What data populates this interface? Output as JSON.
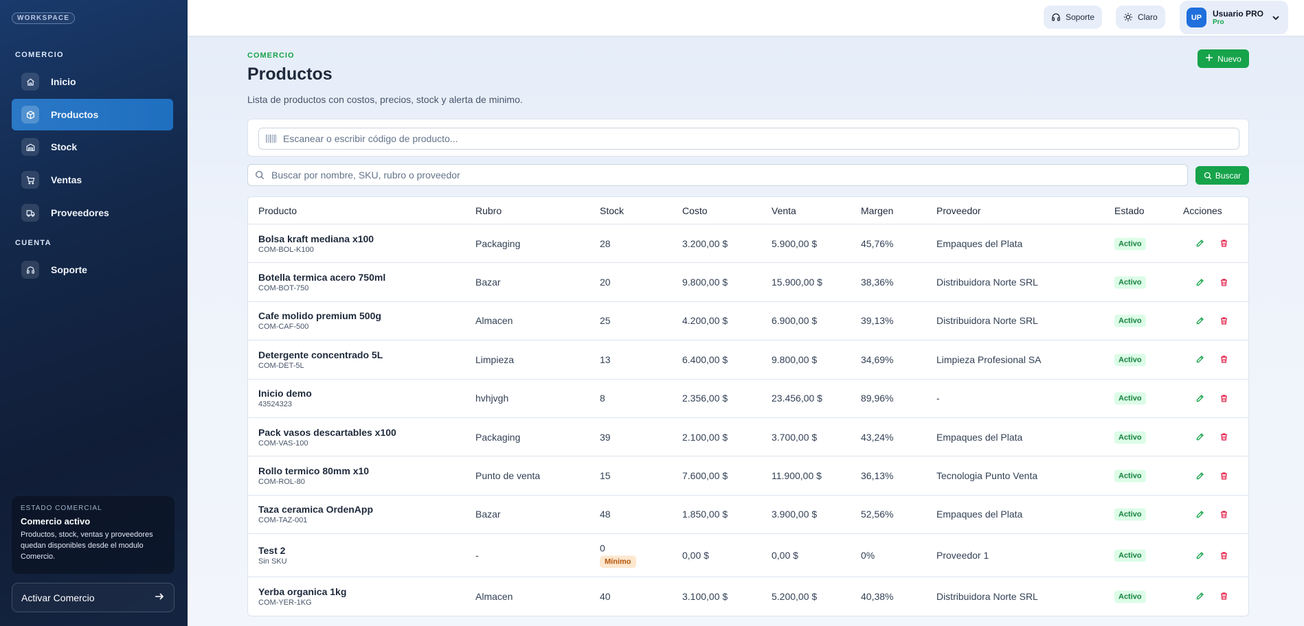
{
  "sidebar": {
    "workspace_badge": "WORKSPACE",
    "section_comercio": "COMERCIO",
    "section_cuenta": "CUENTA",
    "items": [
      {
        "label": "Inicio",
        "icon": "home-icon"
      },
      {
        "label": "Productos",
        "icon": "box-icon"
      },
      {
        "label": "Stock",
        "icon": "warehouse-icon"
      },
      {
        "label": "Ventas",
        "icon": "cart-icon"
      },
      {
        "label": "Proveedores",
        "icon": "truck-icon"
      },
      {
        "label": "Soporte",
        "icon": "headset-icon"
      }
    ],
    "status": {
      "kicker": "ESTADO COMERCIAL",
      "title": "Comercio activo",
      "description": "Productos, stock, ventas y proveedores quedan disponibles desde el modulo Comercio."
    },
    "activate_label": "Activar Comercio"
  },
  "topbar": {
    "support_label": "Soporte",
    "theme_label": "Claro",
    "user": {
      "initials": "UP",
      "name": "Usuario PRO",
      "role": "Pro"
    }
  },
  "page": {
    "eyebrow": "COMERCIO",
    "title": "Productos",
    "subtitle": "Lista de productos con costos, precios, stock y alerta de minimo.",
    "new_button": "Nuevo",
    "scan_placeholder": "Escanear o escribir código de producto...",
    "search_placeholder": "Buscar por nombre, SKU, rubro o proveedor",
    "search_button": "Buscar"
  },
  "table": {
    "columns": [
      "Producto",
      "Rubro",
      "Stock",
      "Costo",
      "Venta",
      "Margen",
      "Proveedor",
      "Estado",
      "Acciones"
    ],
    "rows": [
      {
        "name": "Bolsa kraft mediana x100",
        "sku": "COM-BOL-K100",
        "rubro": "Packaging",
        "stock": "28",
        "costo": "3.200,00 $",
        "venta": "5.900,00 $",
        "margen": "45,76%",
        "proveedor": "Empaques del Plata",
        "estado": "Activo"
      },
      {
        "name": "Botella termica acero 750ml",
        "sku": "COM-BOT-750",
        "rubro": "Bazar",
        "stock": "20",
        "costo": "9.800,00 $",
        "venta": "15.900,00 $",
        "margen": "38,36%",
        "proveedor": "Distribuidora Norte SRL",
        "estado": "Activo"
      },
      {
        "name": "Cafe molido premium 500g",
        "sku": "COM-CAF-500",
        "rubro": "Almacen",
        "stock": "25",
        "costo": "4.200,00 $",
        "venta": "6.900,00 $",
        "margen": "39,13%",
        "proveedor": "Distribuidora Norte SRL",
        "estado": "Activo"
      },
      {
        "name": "Detergente concentrado 5L",
        "sku": "COM-DET-5L",
        "rubro": "Limpieza",
        "stock": "13",
        "costo": "6.400,00 $",
        "venta": "9.800,00 $",
        "margen": "34,69%",
        "proveedor": "Limpieza Profesional SA",
        "estado": "Activo"
      },
      {
        "name": "Inicio demo",
        "sku": "43524323",
        "rubro": "hvhjvgh",
        "stock": "8",
        "costo": "2.356,00 $",
        "venta": "23.456,00 $",
        "margen": "89,96%",
        "proveedor": "-",
        "estado": "Activo"
      },
      {
        "name": "Pack vasos descartables x100",
        "sku": "COM-VAS-100",
        "rubro": "Packaging",
        "stock": "39",
        "costo": "2.100,00 $",
        "venta": "3.700,00 $",
        "margen": "43,24%",
        "proveedor": "Empaques del Plata",
        "estado": "Activo"
      },
      {
        "name": "Rollo termico 80mm x10",
        "sku": "COM-ROL-80",
        "rubro": "Punto de venta",
        "stock": "15",
        "costo": "7.600,00 $",
        "venta": "11.900,00 $",
        "margen": "36,13%",
        "proveedor": "Tecnologia Punto Venta",
        "estado": "Activo"
      },
      {
        "name": "Taza ceramica OrdenApp",
        "sku": "COM-TAZ-001",
        "rubro": "Bazar",
        "stock": "48",
        "costo": "1.850,00 $",
        "venta": "3.900,00 $",
        "margen": "52,56%",
        "proveedor": "Empaques del Plata",
        "estado": "Activo"
      },
      {
        "name": "Test 2",
        "sku": "Sin SKU",
        "rubro": "-",
        "stock": "0",
        "stock_badge": "Mínimo",
        "costo": "0,00 $",
        "venta": "0,00 $",
        "margen": "0%",
        "proveedor": "Proveedor 1",
        "estado": "Activo"
      },
      {
        "name": "Yerba organica 1kg",
        "sku": "COM-YER-1KG",
        "rubro": "Almacen",
        "stock": "40",
        "costo": "3.100,00 $",
        "venta": "5.200,00 $",
        "margen": "40,38%",
        "proveedor": "Distribuidora Norte SRL",
        "estado": "Activo"
      }
    ]
  },
  "colors": {
    "accent": "#16a34a",
    "active_nav": "#2a78c6",
    "delete": "#e11d48"
  }
}
